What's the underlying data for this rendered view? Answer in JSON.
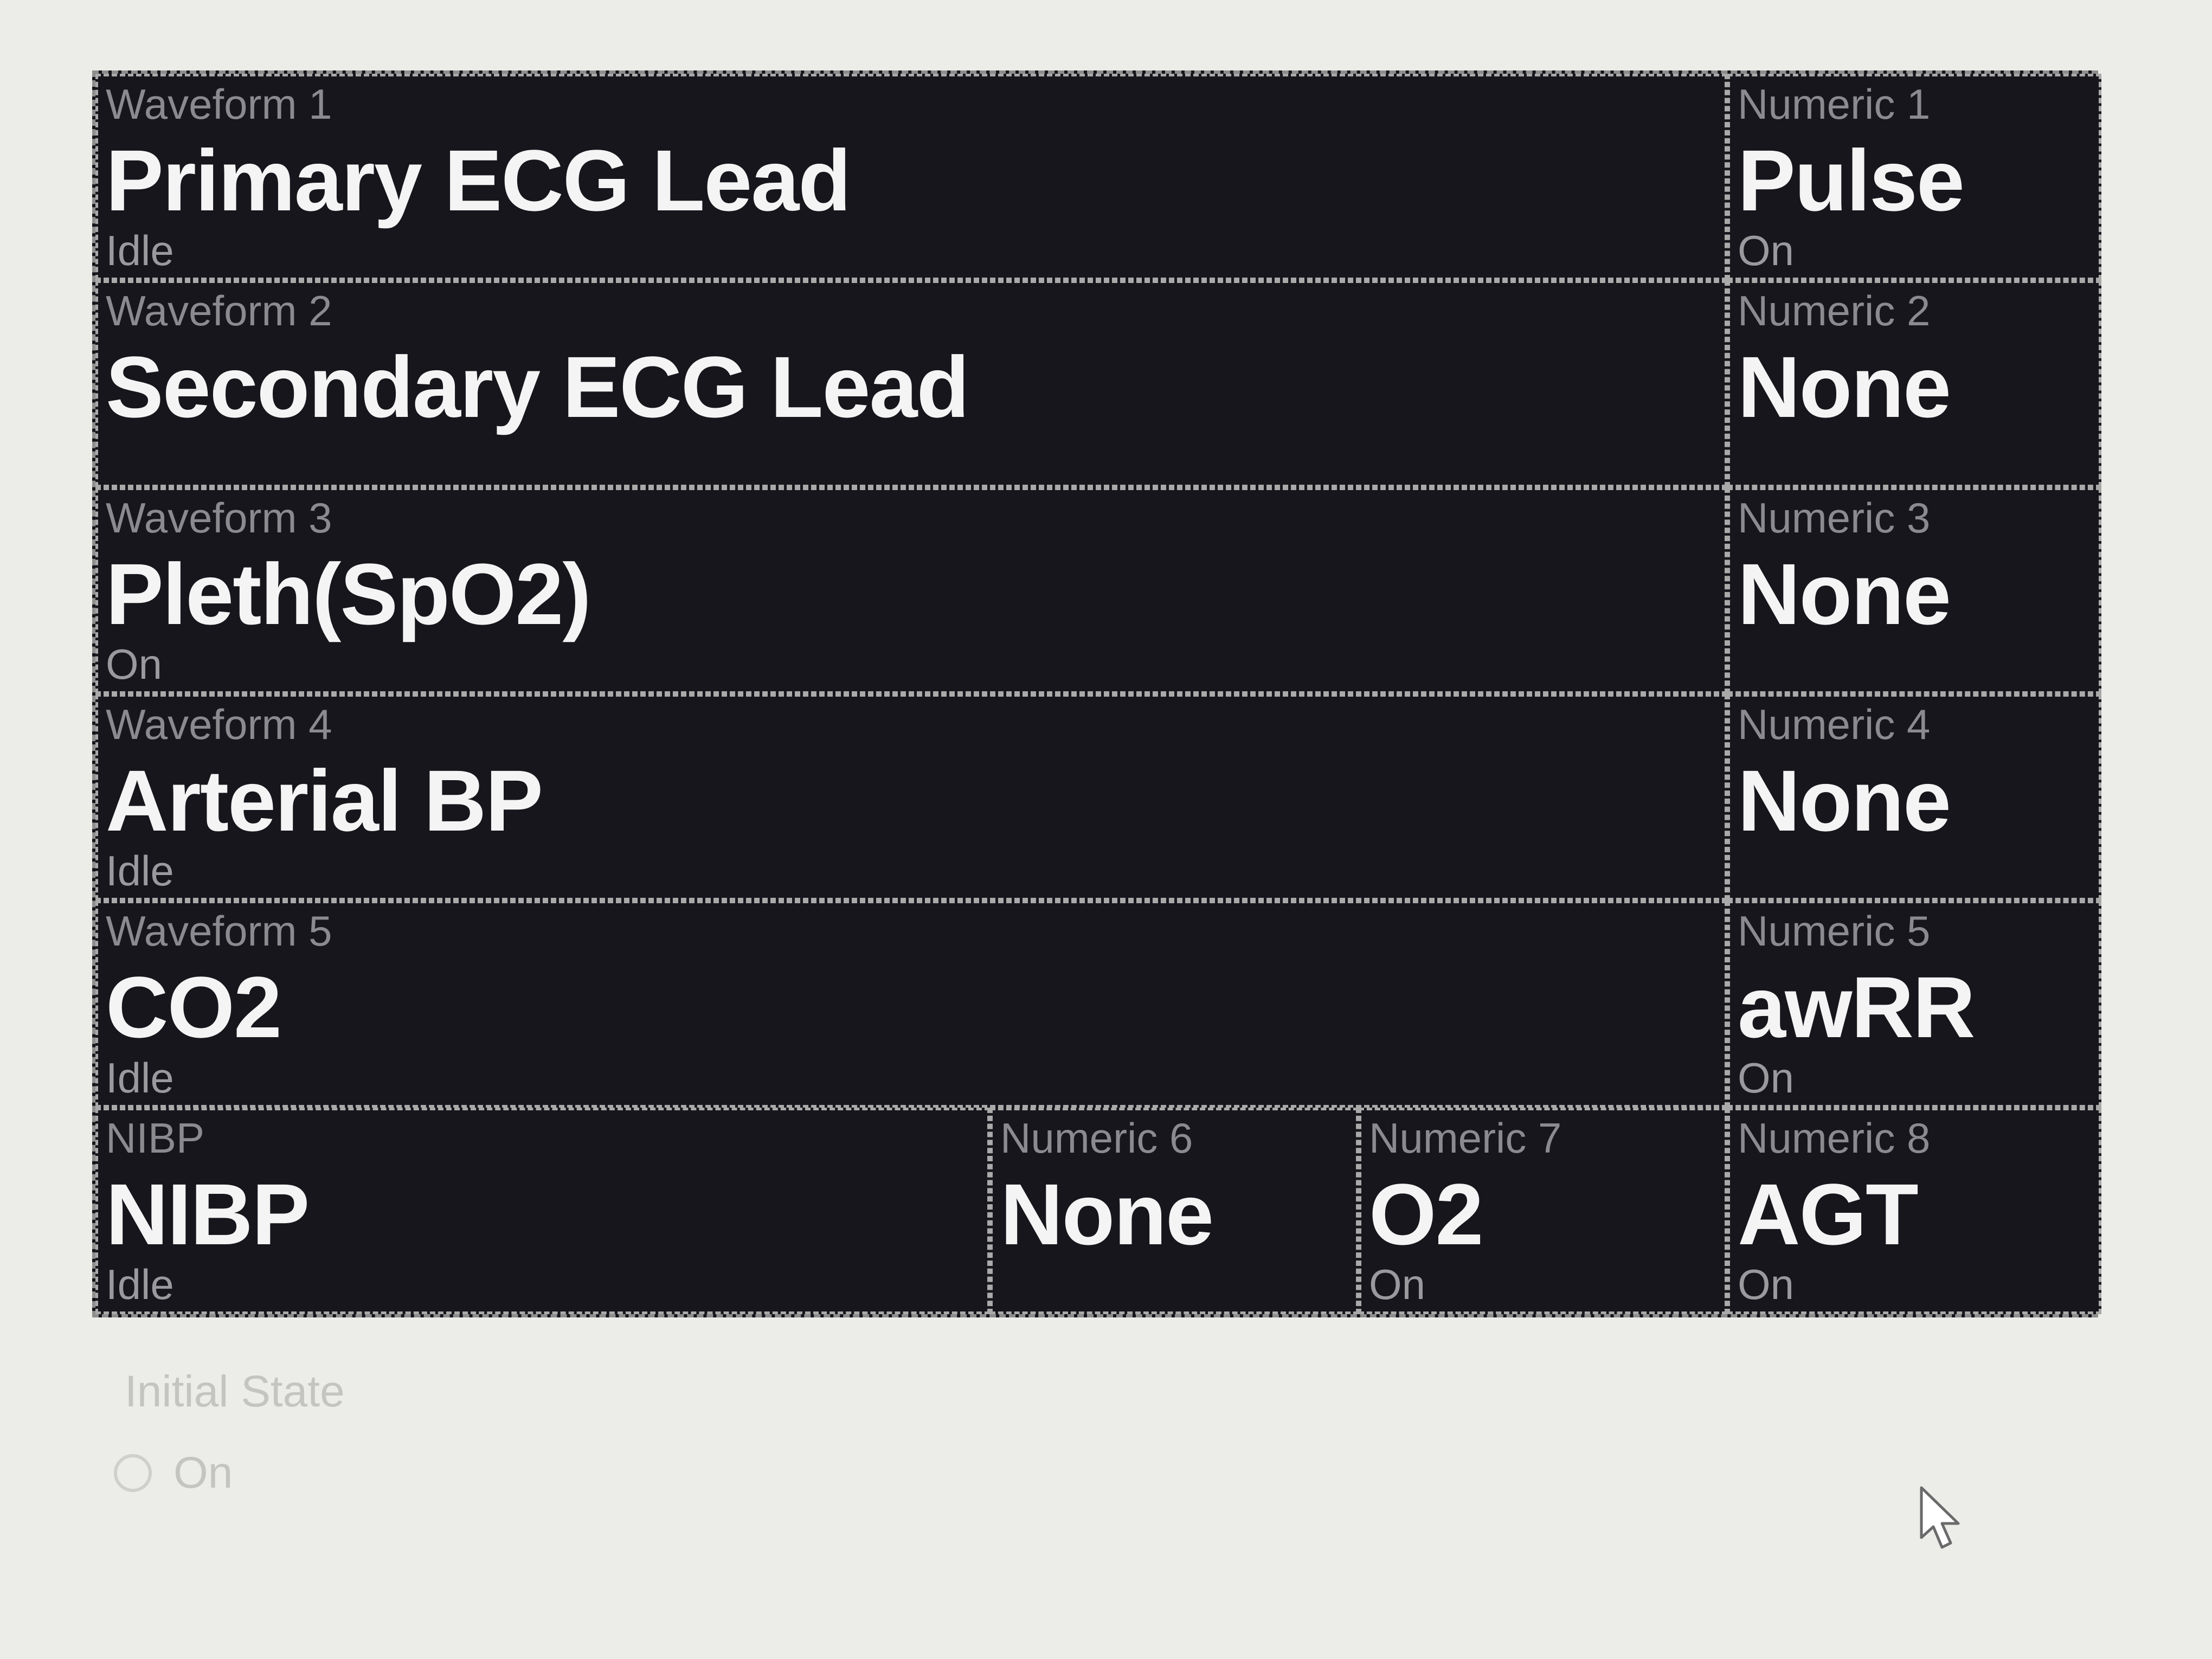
{
  "layout_grid": {
    "waveforms": [
      {
        "slot": "Waveform 1",
        "parameter": "Primary ECG Lead",
        "state": "Idle"
      },
      {
        "slot": "Waveform 2",
        "parameter": "Secondary ECG Lead",
        "state": ""
      },
      {
        "slot": "Waveform 3",
        "parameter": "Pleth(SpO2)",
        "state": "On"
      },
      {
        "slot": "Waveform 4",
        "parameter": "Arterial BP",
        "state": "Idle"
      },
      {
        "slot": "Waveform 5",
        "parameter": "CO2",
        "state": "Idle"
      }
    ],
    "nibp": {
      "slot": "NIBP",
      "parameter": "NIBP",
      "state": "Idle"
    },
    "numerics": [
      {
        "slot": "Numeric 1",
        "parameter": "Pulse",
        "state": "On"
      },
      {
        "slot": "Numeric 2",
        "parameter": "None",
        "state": ""
      },
      {
        "slot": "Numeric 3",
        "parameter": "None",
        "state": ""
      },
      {
        "slot": "Numeric 4",
        "parameter": "None",
        "state": ""
      },
      {
        "slot": "Numeric 5",
        "parameter": "awRR",
        "state": "On"
      },
      {
        "slot": "Numeric 6",
        "parameter": "None",
        "state": ""
      },
      {
        "slot": "Numeric 7",
        "parameter": "O2",
        "state": "On"
      },
      {
        "slot": "Numeric 8",
        "parameter": "AGT",
        "state": "On"
      }
    ]
  },
  "initial_state": {
    "legend": "Initial State",
    "option_on": "On"
  },
  "colors": {
    "cell_background": "#17161c",
    "cell_border": "#a9a9a9",
    "parameter_text": "#f4f4f4",
    "slot_label_text": "#8a8a8f"
  },
  "icons": {
    "cursor": "mouse-pointer-icon"
  }
}
